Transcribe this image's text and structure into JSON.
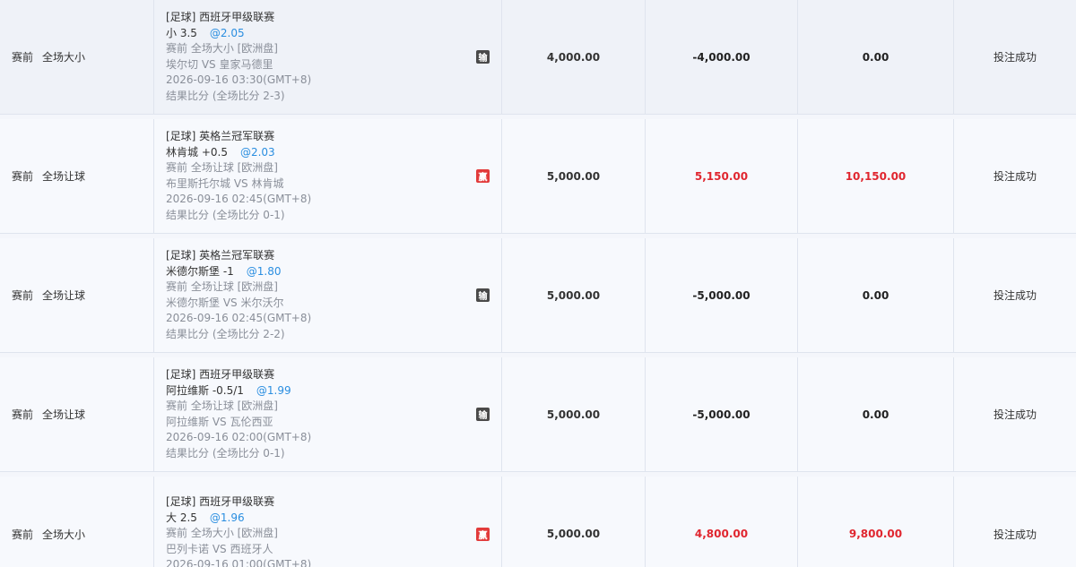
{
  "rows": [
    {
      "bet_time": "赛前",
      "bet_type": "全场大小",
      "league": "[足球] 西班牙甲级联赛",
      "pick": "小 3.5",
      "odds": "@2.05",
      "market": "赛前 全场大小 [欧洲盘]",
      "match": "埃尔切 VS 皇家马德里",
      "kickoff": "2026-09-16 03:30(GMT+8)",
      "result": "结果比分 (全场比分 2-3)",
      "outcome": "输",
      "stake": "4,000.00",
      "win_loss": "-4,000.00",
      "payout": "0.00",
      "status": "投注成功"
    },
    {
      "bet_time": "赛前",
      "bet_type": "全场让球",
      "league": "[足球] 英格兰冠军联赛",
      "pick": "林肯城 +0.5",
      "odds": "@2.03",
      "market": "赛前 全场让球 [欧洲盘]",
      "match": "布里斯托尔城 VS 林肯城",
      "kickoff": "2026-09-16 02:45(GMT+8)",
      "result": "结果比分 (全场比分 0-1)",
      "outcome": "赢",
      "stake": "5,000.00",
      "win_loss": "5,150.00",
      "payout": "10,150.00",
      "status": "投注成功"
    },
    {
      "bet_time": "赛前",
      "bet_type": "全场让球",
      "league": "[足球] 英格兰冠军联赛",
      "pick": "米德尔斯堡 -1",
      "odds": "@1.80",
      "market": "赛前 全场让球 [欧洲盘]",
      "match": "米德尔斯堡 VS 米尔沃尔",
      "kickoff": "2026-09-16 02:45(GMT+8)",
      "result": "结果比分 (全场比分 2-2)",
      "outcome": "输",
      "stake": "5,000.00",
      "win_loss": "-5,000.00",
      "payout": "0.00",
      "status": "投注成功"
    },
    {
      "bet_time": "赛前",
      "bet_type": "全场让球",
      "league": "[足球] 西班牙甲级联赛",
      "pick": "阿拉维斯 -0.5/1",
      "odds": "@1.99",
      "market": "赛前 全场让球 [欧洲盘]",
      "match": "阿拉维斯 VS 瓦伦西亚",
      "kickoff": "2026-09-16 02:00(GMT+8)",
      "result": "结果比分 (全场比分 0-1)",
      "outcome": "输",
      "stake": "5,000.00",
      "win_loss": "-5,000.00",
      "payout": "0.00",
      "status": "投注成功"
    },
    {
      "bet_time": "赛前",
      "bet_type": "全场大小",
      "league": "[足球] 西班牙甲级联赛",
      "pick": "大 2.5",
      "odds": "@1.96",
      "market": "赛前 全场大小 [欧洲盘]",
      "match": "巴列卡诺 VS 西班牙人",
      "kickoff": "2026-09-16 01:00(GMT+8)",
      "result": "",
      "outcome": "赢",
      "stake": "5,000.00",
      "win_loss": "4,800.00",
      "payout": "9,800.00",
      "status": "投注成功"
    }
  ],
  "colors": {
    "odds_blue": "#2a8ee0",
    "win_red": "#e0262f",
    "lose_badge": "#4a4a4a",
    "win_badge": "#e23b3b"
  }
}
